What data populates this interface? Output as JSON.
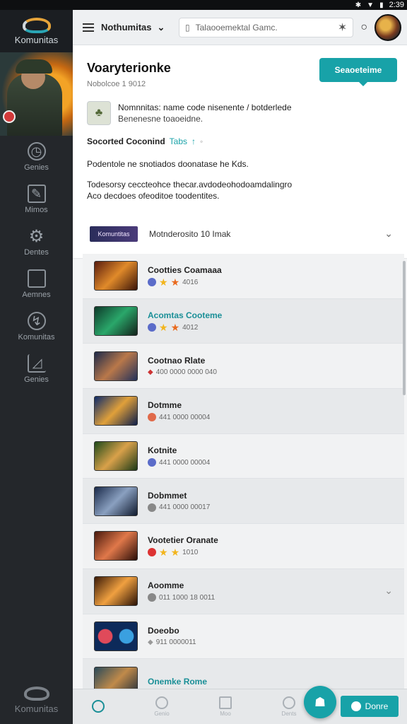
{
  "status": {
    "time": "2:39"
  },
  "rail": {
    "brand": "Komunitas",
    "items": [
      {
        "label": "Genies",
        "icon": "clock-icon"
      },
      {
        "label": "Mimos",
        "icon": "edit-icon"
      },
      {
        "label": "Dentes",
        "icon": "gear-icon"
      },
      {
        "label": "Aemnes",
        "icon": "square-icon"
      },
      {
        "label": "Komunitas",
        "icon": "community-icon"
      },
      {
        "label": "Genies",
        "icon": "chart-icon"
      }
    ],
    "footer_brand": "Komunitas"
  },
  "topbar": {
    "workspace": "Nothumitas",
    "search_placeholder": "Talaooemektal Gamc."
  },
  "header": {
    "title": "Voaryterionke",
    "subtitle": "Nobolcoe 1 9012",
    "cta": "Seaoeteime",
    "profile_name": "Nomnnitas: name code nisenente / botderlede",
    "profile_desc": "Benenesne toaoeidne.",
    "section_title": "Socorted Coconind",
    "section_tab": "Tabs",
    "para1": "Podentole ne snotiados doonatase he Kds.",
    "para2_line1": "Todesorsy ceccteohce thecar.avdodeohodoamdalingro",
    "para2_line2": "Aco decdoes ofeoditoe toodentites."
  },
  "filter": {
    "pill": "Komuntitas",
    "text": "Motnderosito 10 Imak"
  },
  "rows": [
    {
      "title": "Cootties Coamaaa",
      "meta": "4016",
      "stars": 2,
      "teal_tail": true
    },
    {
      "title": "Acomtas Cooteme",
      "meta": "4012",
      "stars": 2,
      "teal_title": true
    },
    {
      "title": "Cootnao Rlate",
      "meta": "400 0000 0000 040"
    },
    {
      "title": "Dotmme",
      "meta": "441 0000 00004"
    },
    {
      "title": "Kotnite",
      "meta": "441 0000 00004"
    },
    {
      "title": "Dobmmet",
      "meta": "441 0000 00017"
    },
    {
      "title": "Vootetier Oranate",
      "meta": "1010",
      "stars": 2
    },
    {
      "title": "Aoomme",
      "meta": "011 1000 18 0011",
      "chevron": true
    },
    {
      "title": "Doeobo",
      "meta": "911 0000011"
    },
    {
      "title": "Onemke Rome",
      "meta": "",
      "teal_title": true
    }
  ],
  "bottomnav": {
    "items": [
      "",
      "Genio",
      "Moo",
      "Dents"
    ],
    "done": "Donre"
  },
  "colors": {
    "accent": "#18a2a8",
    "rail": "#24272b"
  }
}
